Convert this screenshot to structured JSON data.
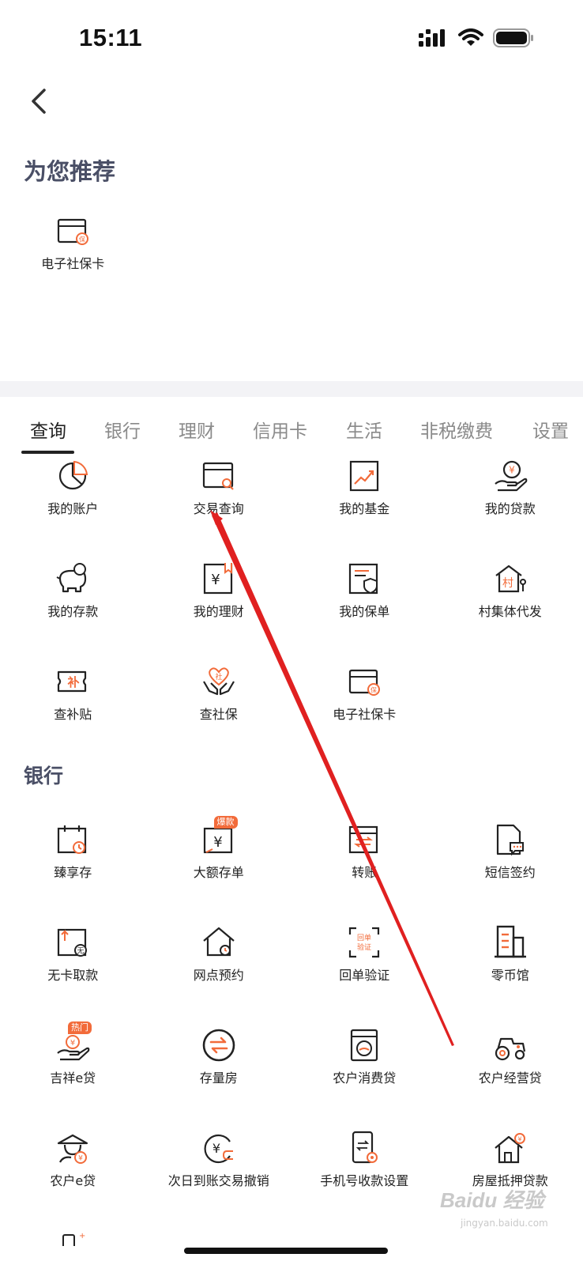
{
  "status_bar": {
    "time": "15:11"
  },
  "header": {
    "back_icon": "chevron-left-icon"
  },
  "recommend": {
    "title": "为您推荐",
    "items": [
      {
        "label": "电子社保卡",
        "icon": "social-security-card-icon"
      }
    ]
  },
  "tabs": [
    {
      "label": "查询",
      "active": true
    },
    {
      "label": "银行",
      "active": false
    },
    {
      "label": "理财",
      "active": false
    },
    {
      "label": "信用卡",
      "active": false
    },
    {
      "label": "生活",
      "active": false
    },
    {
      "label": "非税缴费",
      "active": false
    },
    {
      "label": "设置",
      "active": false
    }
  ],
  "query": {
    "items": [
      {
        "label": "我的账户",
        "icon": "pie-chart-icon"
      },
      {
        "label": "交易查询",
        "icon": "card-search-icon"
      },
      {
        "label": "我的基金",
        "icon": "trend-chart-icon"
      },
      {
        "label": "我的贷款",
        "icon": "hand-coin-icon"
      },
      {
        "label": "我的存款",
        "icon": "piggy-bank-icon"
      },
      {
        "label": "我的理财",
        "icon": "wealth-doc-icon"
      },
      {
        "label": "我的保单",
        "icon": "policy-shield-icon"
      },
      {
        "label": "村集体代发",
        "icon": "village-house-icon"
      },
      {
        "label": "查补贴",
        "icon": "subsidy-ticket-icon"
      },
      {
        "label": "查社保",
        "icon": "hands-heart-icon"
      },
      {
        "label": "电子社保卡",
        "icon": "social-security-card-icon"
      }
    ]
  },
  "bank": {
    "title": "银行",
    "items": [
      {
        "label": "臻享存",
        "icon": "calendar-clock-icon",
        "badge": ""
      },
      {
        "label": "大额存单",
        "icon": "large-deposit-icon",
        "badge": "爆款"
      },
      {
        "label": "转账",
        "icon": "transfer-icon",
        "badge": ""
      },
      {
        "label": "短信签约",
        "icon": "sms-doc-icon",
        "badge": ""
      },
      {
        "label": "无卡取款",
        "icon": "cardless-withdraw-icon",
        "badge": ""
      },
      {
        "label": "网点预约",
        "icon": "branch-home-icon",
        "badge": ""
      },
      {
        "label": "回单验证",
        "icon": "receipt-verify-icon",
        "badge": ""
      },
      {
        "label": "零币馆",
        "icon": "coin-building-icon",
        "badge": ""
      },
      {
        "label": "吉祥e贷",
        "icon": "hand-loan-icon",
        "badge": "热门"
      },
      {
        "label": "存量房",
        "icon": "exchange-circle-icon",
        "badge": ""
      },
      {
        "label": "农户消费贷",
        "icon": "washing-machine-icon",
        "badge": ""
      },
      {
        "label": "农户经营贷",
        "icon": "tractor-icon",
        "badge": ""
      },
      {
        "label": "农户e贷",
        "icon": "farmer-hat-icon",
        "badge": ""
      },
      {
        "label": "次日到账交易撤销",
        "icon": "revoke-coin-icon",
        "badge": ""
      },
      {
        "label": "手机号收款设置",
        "icon": "phone-settings-icon",
        "badge": ""
      },
      {
        "label": "房屋抵押贷款",
        "icon": "house-mortgage-icon",
        "badge": ""
      }
    ]
  },
  "watermark": {
    "brand": "Baidu 经验",
    "url": "jingyan.baidu.com"
  },
  "colors": {
    "accent": "#f26b3a",
    "icon_stroke": "#222222",
    "annotation_arrow": "#e02020",
    "section_title": "#4a4f66",
    "tab_inactive": "#8a8a8a"
  }
}
